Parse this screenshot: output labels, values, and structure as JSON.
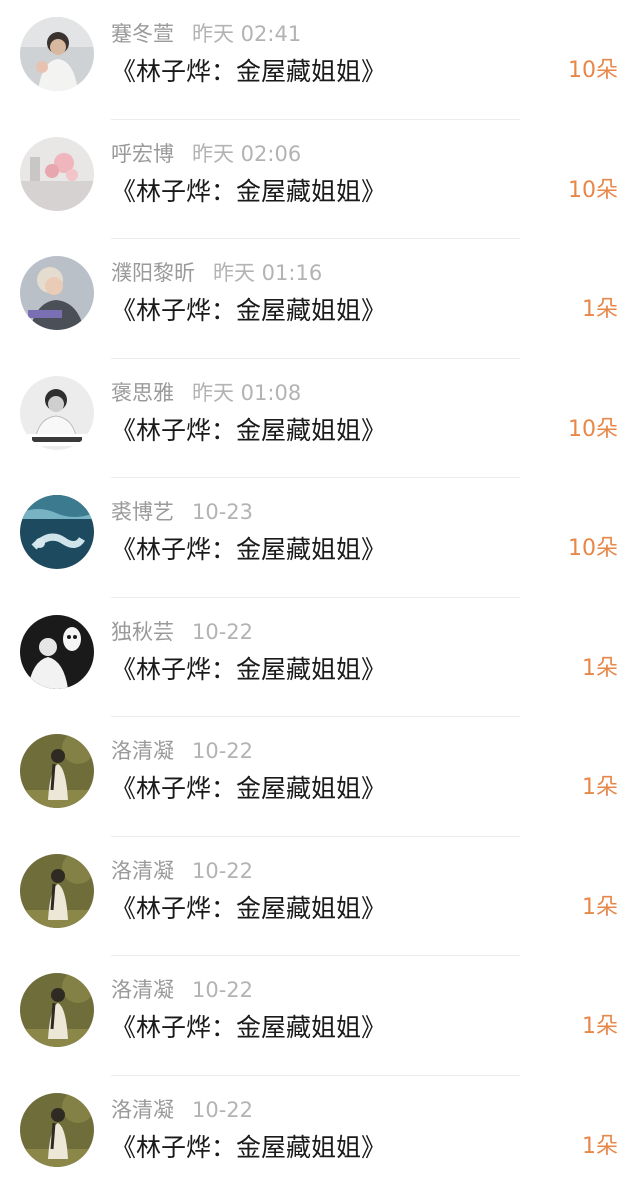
{
  "gifts": [
    {
      "name": "蹇冬萱",
      "time": "昨天 02:41",
      "title": "《林子烨：金屋藏姐姐》",
      "amount": "10朵",
      "avatar": "avatar-man-white-shirt"
    },
    {
      "name": "呼宏博",
      "time": "昨天 02:06",
      "title": "《林子烨：金屋藏姐姐》",
      "amount": "10朵",
      "avatar": "avatar-pink-roses"
    },
    {
      "name": "濮阳黎昕",
      "time": "昨天 01:16",
      "title": "《林子烨：金屋藏姐姐》",
      "amount": "1朵",
      "avatar": "avatar-boy-portrait"
    },
    {
      "name": "褒思雅",
      "time": "昨天 01:08",
      "title": "《林子烨：金屋藏姐姐》",
      "amount": "10朵",
      "avatar": "avatar-bw-portrait"
    },
    {
      "name": "裘博艺",
      "time": "10-23",
      "title": "《林子烨：金屋藏姐姐》",
      "amount": "10朵",
      "avatar": "avatar-underwater"
    },
    {
      "name": "独秋芸",
      "time": "10-22",
      "title": "《林子烨：金屋藏姐姐》",
      "amount": "1朵",
      "avatar": "avatar-bw-mask"
    },
    {
      "name": "洛清凝",
      "time": "10-22",
      "title": "《林子烨：金屋藏姐姐》",
      "amount": "1朵",
      "avatar": "avatar-olive-figure"
    },
    {
      "name": "洛清凝",
      "time": "10-22",
      "title": "《林子烨：金屋藏姐姐》",
      "amount": "1朵",
      "avatar": "avatar-olive-figure"
    },
    {
      "name": "洛清凝",
      "time": "10-22",
      "title": "《林子烨：金屋藏姐姐》",
      "amount": "1朵",
      "avatar": "avatar-olive-figure"
    },
    {
      "name": "洛清凝",
      "time": "10-22",
      "title": "《林子烨：金屋藏姐姐》",
      "amount": "1朵",
      "avatar": "avatar-olive-figure"
    }
  ],
  "colors": {
    "amount": "#e8874a",
    "name": "#9a9a9a",
    "title": "#1a1a1a"
  }
}
